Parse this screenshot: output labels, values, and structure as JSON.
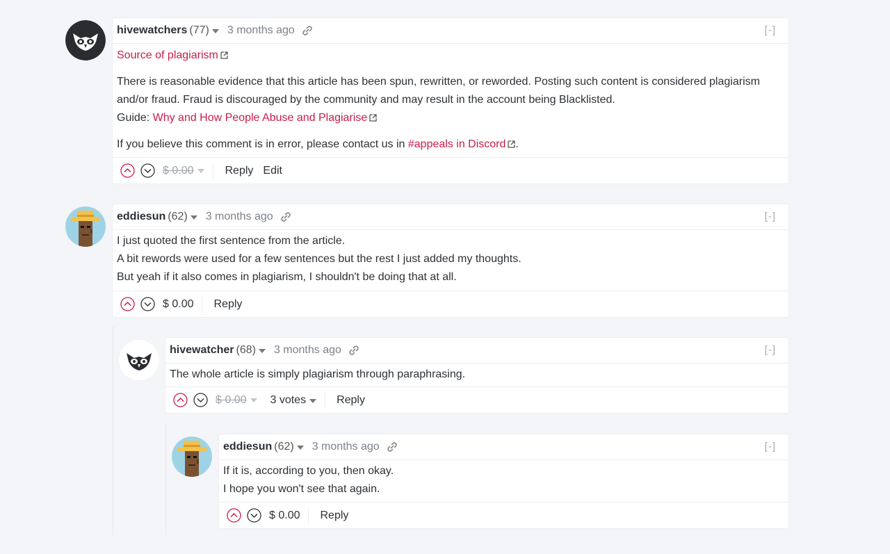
{
  "colors": {
    "accent": "#c91d48",
    "background": "#f4f5f9",
    "card": "#ffffff",
    "muted": "#7d8187"
  },
  "comments": [
    {
      "author": "hivewatchers",
      "reputation": "(77)",
      "time": "3 months ago",
      "collapse": "[-]",
      "avatar_icon": "owl-logo-icon-dark",
      "source_link": "Source of plagiarism",
      "para1": "There is reasonable evidence that this article has been spun, rewritten, or reworded. Posting such content is considered plagiarism and/or fraud. Fraud is discouraged by the community and may result in the account being Blacklisted.",
      "guide_prefix": "Guide: ",
      "guide_link": "Why and How People Abuse and Plagiarise",
      "para3_prefix": "If you believe this comment is in error, please contact us in ",
      "para3_link": "#appeals in Discord",
      "para3_suffix": ".",
      "payout": "$ 0.00",
      "reply": "Reply",
      "edit": "Edit"
    },
    {
      "author": "eddiesun",
      "reputation": "(62)",
      "time": "3 months ago",
      "collapse": "[-]",
      "avatar_icon": "pixel-avatar-icon",
      "lines": [
        "I just quoted the first sentence from the article.",
        "A bit rewords were used for a few sentences but the rest I just added my thoughts.",
        "But yeah if it also comes in plagiarism, I shouldn't be doing that at all."
      ],
      "payout": "$ 0.00",
      "reply": "Reply"
    },
    {
      "author": "hivewatcher",
      "reputation": "(68)",
      "time": "3 months ago",
      "collapse": "[-]",
      "avatar_icon": "owl-logo-icon-light",
      "lines": [
        "The whole article is simply plagiarism through paraphrasing."
      ],
      "payout": "$ 0.00",
      "votes": "3 votes",
      "reply": "Reply"
    },
    {
      "author": "eddiesun",
      "reputation": "(62)",
      "time": "3 months ago",
      "collapse": "[-]",
      "avatar_icon": "pixel-avatar-icon",
      "lines": [
        "If it is, according to you, then okay.",
        "I hope you won't see that again."
      ],
      "payout": "$ 0.00",
      "reply": "Reply"
    }
  ]
}
